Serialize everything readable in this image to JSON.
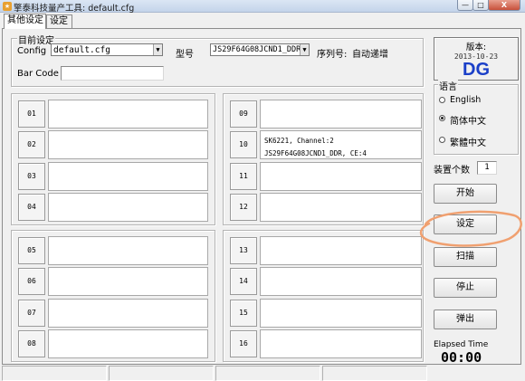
{
  "window": {
    "title": "擎泰科技量产工具: default.cfg",
    "min_label": "—",
    "max_label": "□",
    "close_label": "X",
    "app_icon_glyph": "★"
  },
  "tabs": [
    {
      "label": "其他设定"
    },
    {
      "label": "设定"
    }
  ],
  "settings_group": {
    "label": "目前设定",
    "config_label": "Config",
    "config_value": "default.cfg",
    "model_label": "型号",
    "model_value": "JS29F64G08JCND1_DDR",
    "serial_label": "序列号:",
    "serial_value": "自动递增",
    "barcode_label": "Bar Code",
    "barcode_value": ""
  },
  "slots": [
    {
      "id": "01",
      "info": []
    },
    {
      "id": "02",
      "info": []
    },
    {
      "id": "03",
      "info": []
    },
    {
      "id": "04",
      "info": []
    },
    {
      "id": "05",
      "info": []
    },
    {
      "id": "06",
      "info": []
    },
    {
      "id": "07",
      "info": []
    },
    {
      "id": "08",
      "info": []
    },
    {
      "id": "09",
      "info": []
    },
    {
      "id": "10",
      "info": [
        "SK6221, Channel:2",
        "JS29F64G08JCND1_DDR, CE:4"
      ]
    },
    {
      "id": "11",
      "info": []
    },
    {
      "id": "12",
      "info": []
    },
    {
      "id": "13",
      "info": []
    },
    {
      "id": "14",
      "info": []
    },
    {
      "id": "15",
      "info": []
    },
    {
      "id": "16",
      "info": []
    }
  ],
  "version": {
    "label": "版本:",
    "date": "2013-10-23",
    "code": "DG",
    "code_color": "#1a3fc8"
  },
  "language_group": {
    "label": "语言",
    "options": [
      {
        "label": "English",
        "checked": false
      },
      {
        "label": "简体中文",
        "checked": true
      },
      {
        "label": "繁體中文",
        "checked": false
      }
    ]
  },
  "device_count": {
    "label": "装置个数",
    "value": "1"
  },
  "buttons": {
    "start": "开始",
    "settings": "设定",
    "scan": "扫描",
    "stop": "停止",
    "eject": "弹出"
  },
  "elapsed": {
    "label": "Elapsed Time",
    "value": "00:00"
  },
  "annotation": {
    "color": "#f0a070"
  }
}
